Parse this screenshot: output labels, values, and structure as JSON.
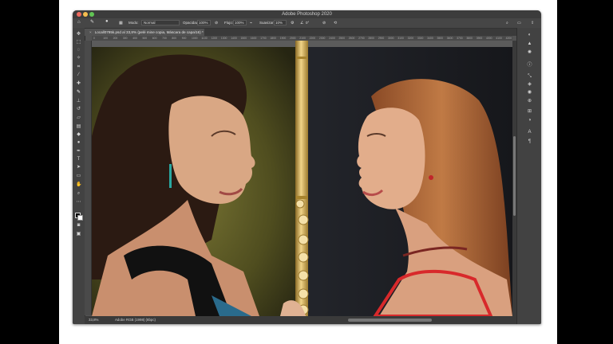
{
  "window": {
    "title": "Adobe Photoshop 2020"
  },
  "options_bar": {
    "mode_label": "Modo:",
    "mode_value": "Normal",
    "opacity_label": "Opacidad:",
    "opacity_value": "100%",
    "flow_label": "Flujo:",
    "flow_value": "100%",
    "smoothing_label": "Suavizar:",
    "smoothing_value": "10%",
    "angle_value": "0°"
  },
  "document": {
    "tab_title": "Locall0795k.psd al 33,8% (pelé mine copia, Máscara de capa/16) *",
    "close_glyph": "×"
  },
  "ruler": {
    "ticks": [
      "0",
      "100",
      "200",
      "300",
      "400",
      "500",
      "600",
      "700",
      "800",
      "900",
      "1000",
      "1100",
      "1200",
      "1300",
      "1400",
      "1500",
      "1600",
      "1700",
      "1800",
      "1900",
      "2000",
      "2100",
      "2200",
      "2300",
      "2400",
      "2500",
      "2600",
      "2700",
      "2800",
      "2900",
      "3000",
      "3100",
      "3200",
      "3300",
      "3400",
      "3500",
      "3600",
      "3700",
      "3800",
      "3900",
      "4000",
      "4100",
      "4200",
      "4300"
    ]
  },
  "status": {
    "zoom": "33,8%",
    "info": "Adobe RGB (1998) (8bpc)"
  },
  "tools": [
    "move-icon",
    "marquee-icon",
    "lasso-icon",
    "quick-select-icon",
    "crop-icon",
    "eyedropper-icon",
    "healing-icon",
    "brush-icon",
    "stamp-icon",
    "history-brush-icon",
    "eraser-icon",
    "gradient-icon",
    "blur-icon",
    "dodge-icon",
    "pen-icon",
    "type-icon",
    "path-select-icon",
    "rectangle-icon",
    "hand-icon",
    "zoom-icon",
    "more-icon"
  ],
  "panels": [
    "color-icon",
    "adjust-icon",
    "layers-icon",
    "channels-icon",
    "paths-icon",
    "properties-icon",
    "history-icon",
    "actions-icon",
    "libraries-icon",
    "brushes-icon",
    "character-icon",
    "paragraph-icon"
  ],
  "colors": {
    "app_dark": "#535353",
    "panel": "#424242",
    "bg_left_warm": "#6f6a2a",
    "bg_right_dark": "#1d1f24",
    "flute_gold": "#d9b25a"
  }
}
